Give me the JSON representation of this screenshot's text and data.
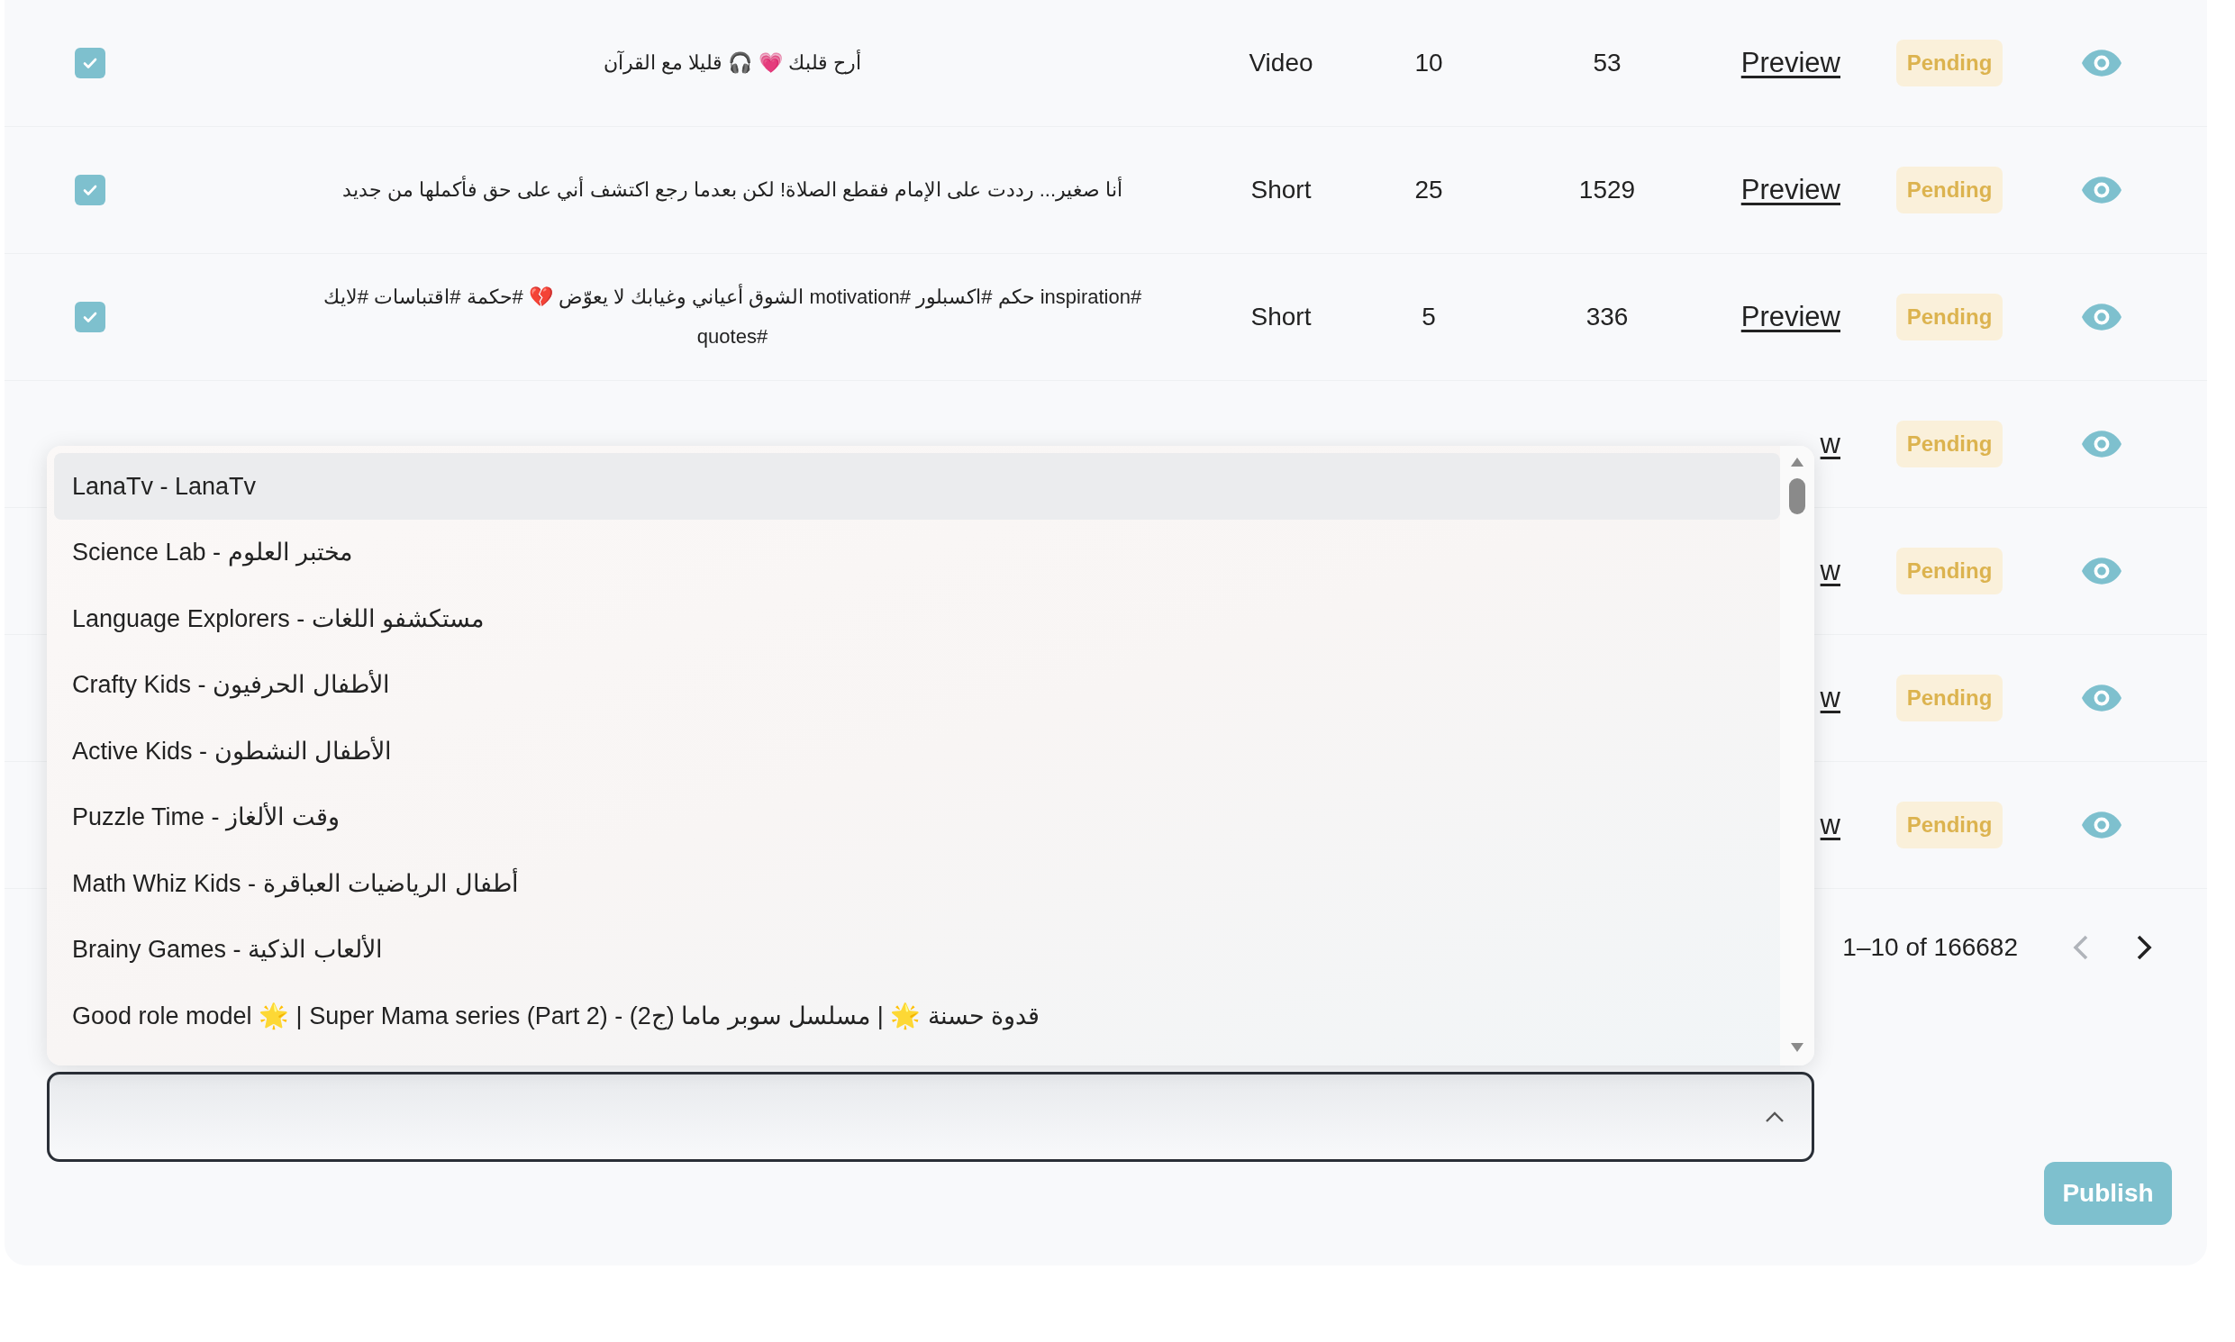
{
  "rows": [
    {
      "checked": true,
      "title": "أرح قلبك 💗 🎧 قليلا مع القرآن",
      "type": "Video",
      "count": "10",
      "views": "53",
      "preview": "Preview",
      "status": "Pending"
    },
    {
      "checked": true,
      "title": "أنا صغير... رددت على الإمام فقطع الصلاة! لكن بعدما رجع اكتشف أني على حق فأكملها من جديد",
      "type": "Short",
      "count": "25",
      "views": "1529",
      "preview": "Preview",
      "status": "Pending"
    },
    {
      "checked": true,
      "title": "#inspiration حكم #اكسبلور #motivation الشوق أعياني وغيابك لا يعوّض 💔 #حكمة #اقتباسات #لايك #quotes",
      "type": "Short",
      "count": "5",
      "views": "336",
      "preview": "Preview",
      "status": "Pending"
    },
    {
      "preview": "w",
      "status": "Pending"
    },
    {
      "preview": "w",
      "status": "Pending"
    },
    {
      "preview": "w",
      "status": "Pending"
    },
    {
      "preview": "w",
      "status": "Pending"
    }
  ],
  "pagination": {
    "range": "1–10 of 166682",
    "prev_disabled": true,
    "next_disabled": false
  },
  "channel_dropdown": {
    "expanded": true,
    "options": [
      {
        "label": "LanaTv - LanaTv",
        "selected": true
      },
      {
        "label": "Science Lab - مختبر العلوم",
        "selected": false
      },
      {
        "label": "Language Explorers - مستكشفو اللغات",
        "selected": false
      },
      {
        "label": "Crafty Kids - الأطفال الحرفيون",
        "selected": false
      },
      {
        "label": "Active Kids - الأطفال النشطون",
        "selected": false
      },
      {
        "label": "Puzzle Time - وقت الألغاز",
        "selected": false
      },
      {
        "label": "Math Whiz Kids - أطفال الرياضيات العباقرة",
        "selected": false
      },
      {
        "label": "Brainy Games - الألعاب الذكية",
        "selected": false
      },
      {
        "label": "Good role model 🌟 | Super Mama series (Part 2) - قدوة حسنة 🌟 | مسلسل سوبر ماما (ج2)",
        "selected": false
      }
    ]
  },
  "publish_button": "Publish"
}
